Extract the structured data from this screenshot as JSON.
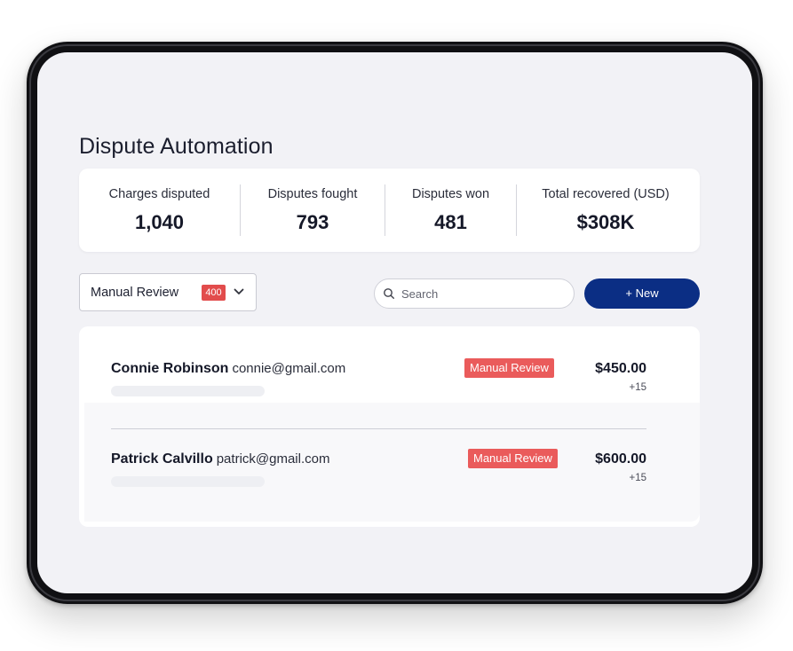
{
  "page": {
    "title": "Dispute Automation"
  },
  "stats": [
    {
      "label": "Charges disputed",
      "value": "1,040"
    },
    {
      "label": "Disputes fought",
      "value": "793"
    },
    {
      "label": "Disputes won",
      "value": "481"
    },
    {
      "label": "Total recovered (USD)",
      "value": "$308K"
    }
  ],
  "toolbar": {
    "filter": {
      "selected": "Manual Review",
      "count": "400",
      "icon": "chevron-down-icon"
    },
    "search": {
      "placeholder": "Search",
      "value": "",
      "icon": "search-icon"
    },
    "new_button_label": "+ New"
  },
  "disputes": [
    {
      "name": "Connie Robinson",
      "email": "connie@gmail.com",
      "status": "Manual Review",
      "amount": "$450.00",
      "extra": "+15"
    },
    {
      "name": "Patrick Calvillo",
      "email": "patrick@gmail.com",
      "status": "Manual Review",
      "amount": "$600.00",
      "extra": "+15"
    }
  ],
  "colors": {
    "primary_button": "#0b2e84",
    "status_badge": "#ea5b5b",
    "count_badge": "#e24c4c",
    "screen_background": "#f2f2f6"
  }
}
